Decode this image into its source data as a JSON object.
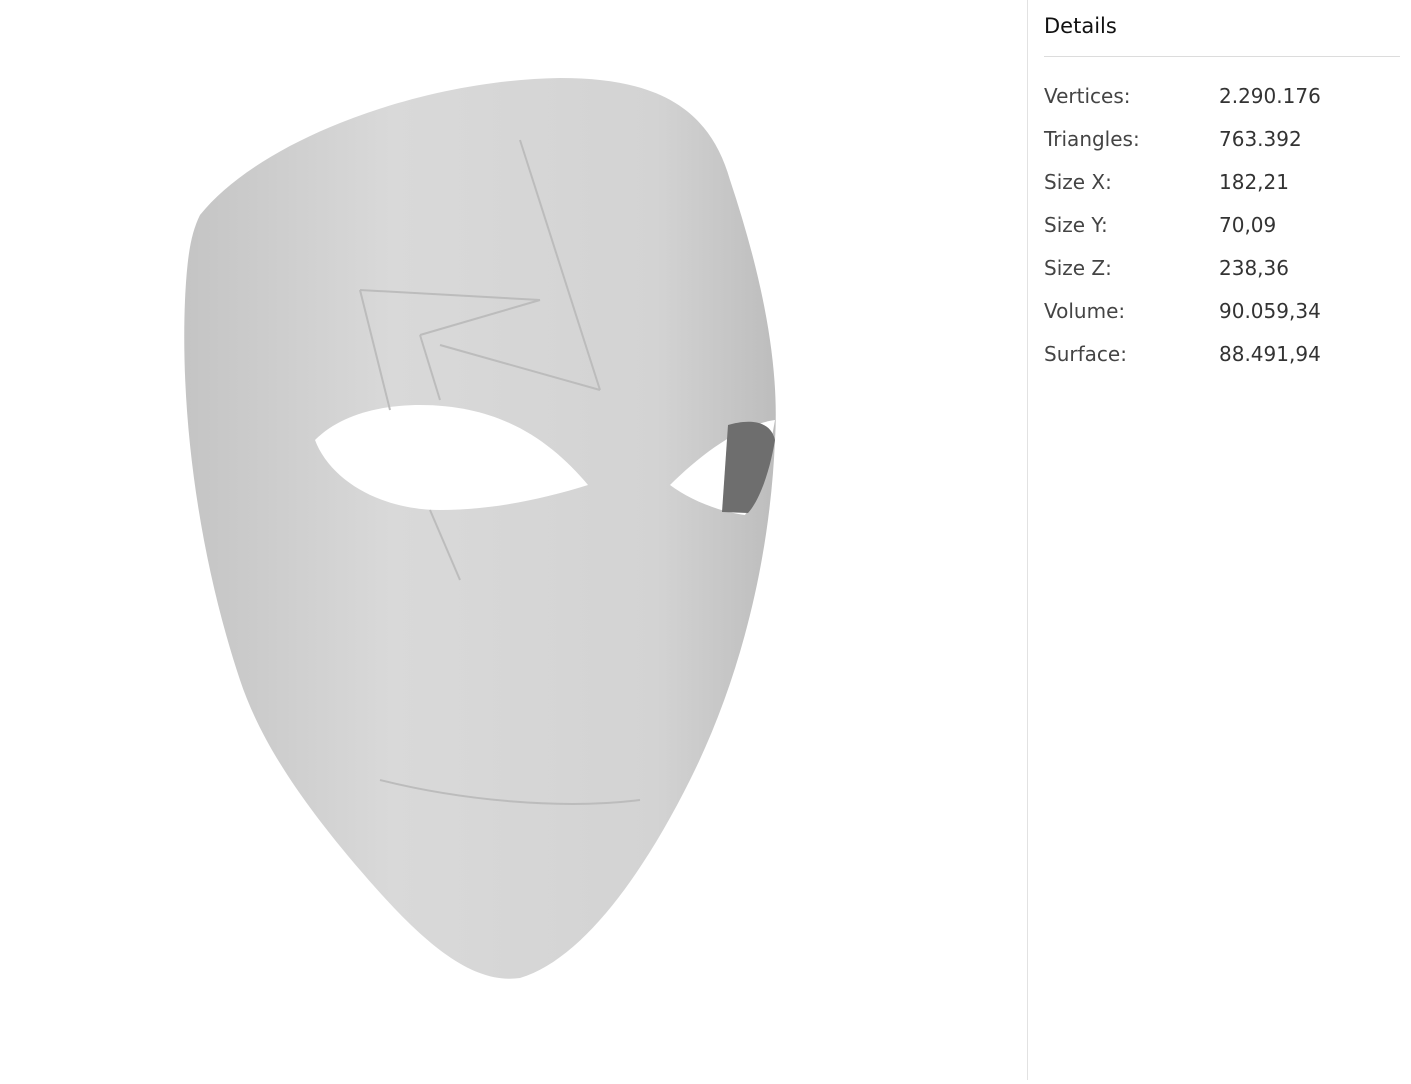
{
  "details": {
    "title": "Details",
    "rows": [
      {
        "label": "Vertices:",
        "value": "2.290.176"
      },
      {
        "label": "Triangles:",
        "value": "763.392"
      },
      {
        "label": "Size X:",
        "value": "182,21"
      },
      {
        "label": "Size Y:",
        "value": "70,09"
      },
      {
        "label": "Size Z:",
        "value": "238,36"
      },
      {
        "label": "Volume:",
        "value": "90.059,34"
      },
      {
        "label": "Surface:",
        "value": "88.491,94"
      }
    ]
  }
}
